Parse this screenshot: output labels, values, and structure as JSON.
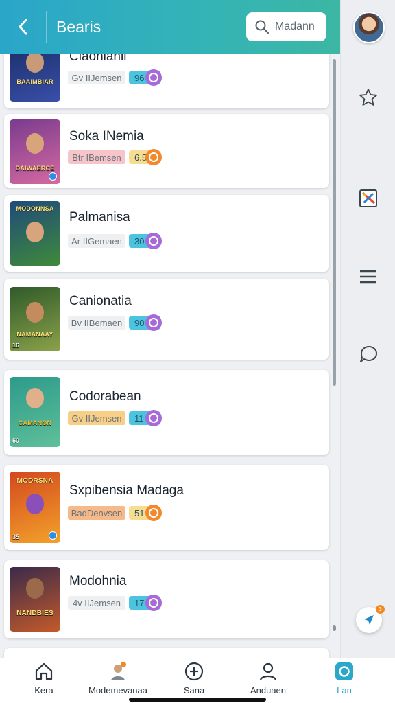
{
  "header": {
    "title": "Bearis",
    "search_placeholder": "Madann"
  },
  "games": [
    {
      "title": "Claonianii",
      "tag": "Gv IIJemsen",
      "tag_color": "#eef0f2",
      "score": "96",
      "score_color": "#4cc4e0",
      "circle_color": "#a86ad8",
      "thumb_title": "BAAIMBIAR",
      "thumb_bg": [
        "#1b2f6b",
        "#3a4fa8"
      ]
    },
    {
      "title": "Soka INemia",
      "tag": "Btr IBemsen",
      "tag_color": "#f7c4c9",
      "score": "6.5",
      "score_color": "#f8dc92",
      "circle_color": "#f08a2c",
      "thumb_title": "DAIWAERCE",
      "thumb_bg": [
        "#7a3b8e",
        "#d56aa0"
      ],
      "thumb_num": ""
    },
    {
      "title": "Palmanisa",
      "tag": "Ar IIGemaen",
      "tag_color": "#eef0f2",
      "score": "30",
      "score_color": "#4cc4e0",
      "circle_color": "#a86ad8",
      "thumb_title": "MODONNSA",
      "thumb_bg": [
        "#1f4a7a",
        "#3f8a3a"
      ]
    },
    {
      "title": "Canionatia",
      "tag": "Bv IIBemaen",
      "tag_color": "#eef0f2",
      "score": "90",
      "score_color": "#4cc4e0",
      "circle_color": "#a86ad8",
      "thumb_title": "NAMANAAY",
      "thumb_bg": [
        "#2f5a2a",
        "#8ba24a"
      ],
      "thumb_num": "16"
    },
    {
      "title": "Codorabean",
      "tag": "Gv IIJemsen",
      "tag_color": "#f8cf86",
      "score": "11",
      "score_color": "#4cc4e0",
      "circle_color": "#a86ad8",
      "thumb_title": "CAMANON",
      "thumb_bg": [
        "#2d9a8a",
        "#5fc09a"
      ],
      "thumb_num": "50"
    },
    {
      "title": "Sxpibensia Madaga",
      "tag": "BadDenvsen",
      "tag_color": "#f6b98a",
      "score": "51",
      "score_color": "#f8dc92",
      "circle_color": "#f08a2c",
      "thumb_title": "MODRSNA",
      "thumb_bg": [
        "#d3481f",
        "#f3a22a"
      ],
      "thumb_num": "35"
    },
    {
      "title": "Modohnia",
      "tag": "4v IIJemsen",
      "tag_color": "#eef0f2",
      "score": "17",
      "score_color": "#4cc4e0",
      "circle_color": "#a86ad8",
      "thumb_title": "NANDBIES",
      "thumb_bg": [
        "#3a2a4a",
        "#c45a2a"
      ]
    }
  ],
  "rail": {
    "icons": [
      "star-icon",
      "image-icon",
      "menu-icon",
      "chat-icon"
    ],
    "fab_badge": "3"
  },
  "bottom_nav": [
    {
      "label": "Kera",
      "icon": "home-icon"
    },
    {
      "label": "Modemevanaa",
      "icon": "character-icon",
      "badge": "1"
    },
    {
      "label": "Sana",
      "icon": "add-icon"
    },
    {
      "label": "Anduaen",
      "icon": "person-icon"
    },
    {
      "label": "Lan",
      "icon": "app-icon",
      "active": true
    }
  ]
}
